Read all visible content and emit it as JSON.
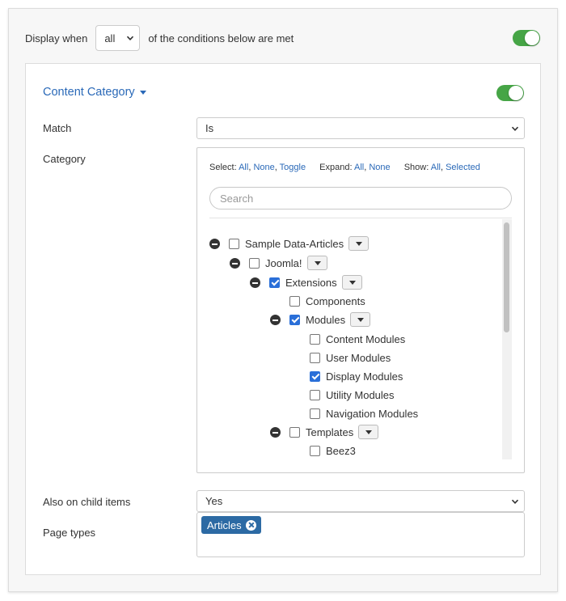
{
  "display_condition": {
    "prefix": "Display when",
    "value": "all",
    "suffix": "of the conditions below are met",
    "enabled": true
  },
  "content_category": {
    "title": "Content Category",
    "enabled": true,
    "match": {
      "label": "Match",
      "value": "Is"
    },
    "category": {
      "label": "Category",
      "controls": {
        "select": {
          "label": "Select:",
          "all": "All",
          "none": "None",
          "toggle": "Toggle"
        },
        "expand": {
          "label": "Expand:",
          "all": "All",
          "none": "None"
        },
        "show": {
          "label": "Show:",
          "all": "All",
          "selected": "Selected"
        }
      },
      "search_placeholder": "Search",
      "tree": [
        {
          "label": "Sample Data-Articles",
          "checked": false,
          "collapsible": true,
          "dropdown": true
        },
        {
          "label": "Joomla!",
          "checked": false,
          "collapsible": true,
          "dropdown": true
        },
        {
          "label": "Extensions",
          "checked": true,
          "collapsible": true,
          "dropdown": true
        },
        {
          "label": "Components",
          "checked": false,
          "collapsible": false,
          "dropdown": false
        },
        {
          "label": "Modules",
          "checked": true,
          "collapsible": true,
          "dropdown": true
        },
        {
          "label": "Content Modules",
          "checked": false,
          "collapsible": false,
          "dropdown": false
        },
        {
          "label": "User Modules",
          "checked": false,
          "collapsible": false,
          "dropdown": false
        },
        {
          "label": "Display Modules",
          "checked": true,
          "collapsible": false,
          "dropdown": false
        },
        {
          "label": "Utility Modules",
          "checked": false,
          "collapsible": false,
          "dropdown": false
        },
        {
          "label": "Navigation Modules",
          "checked": false,
          "collapsible": false,
          "dropdown": false
        },
        {
          "label": "Templates",
          "checked": false,
          "collapsible": true,
          "dropdown": true
        },
        {
          "label": "Beez3",
          "checked": false,
          "collapsible": false,
          "dropdown": false
        }
      ]
    },
    "child_items": {
      "label": "Also on child items",
      "value": "Yes"
    },
    "page_types": {
      "label": "Page types",
      "tags": [
        "Articles"
      ]
    }
  },
  "colors": {
    "accent": "#2a69b8",
    "toggle_on": "#46a546",
    "tag_bg": "#2c6aa4",
    "checkbox_checked": "#2a6fd8"
  },
  "icons": [
    "chevron-down-icon",
    "caret-down-icon",
    "collapse-minus-icon",
    "remove-tag-icon"
  ]
}
